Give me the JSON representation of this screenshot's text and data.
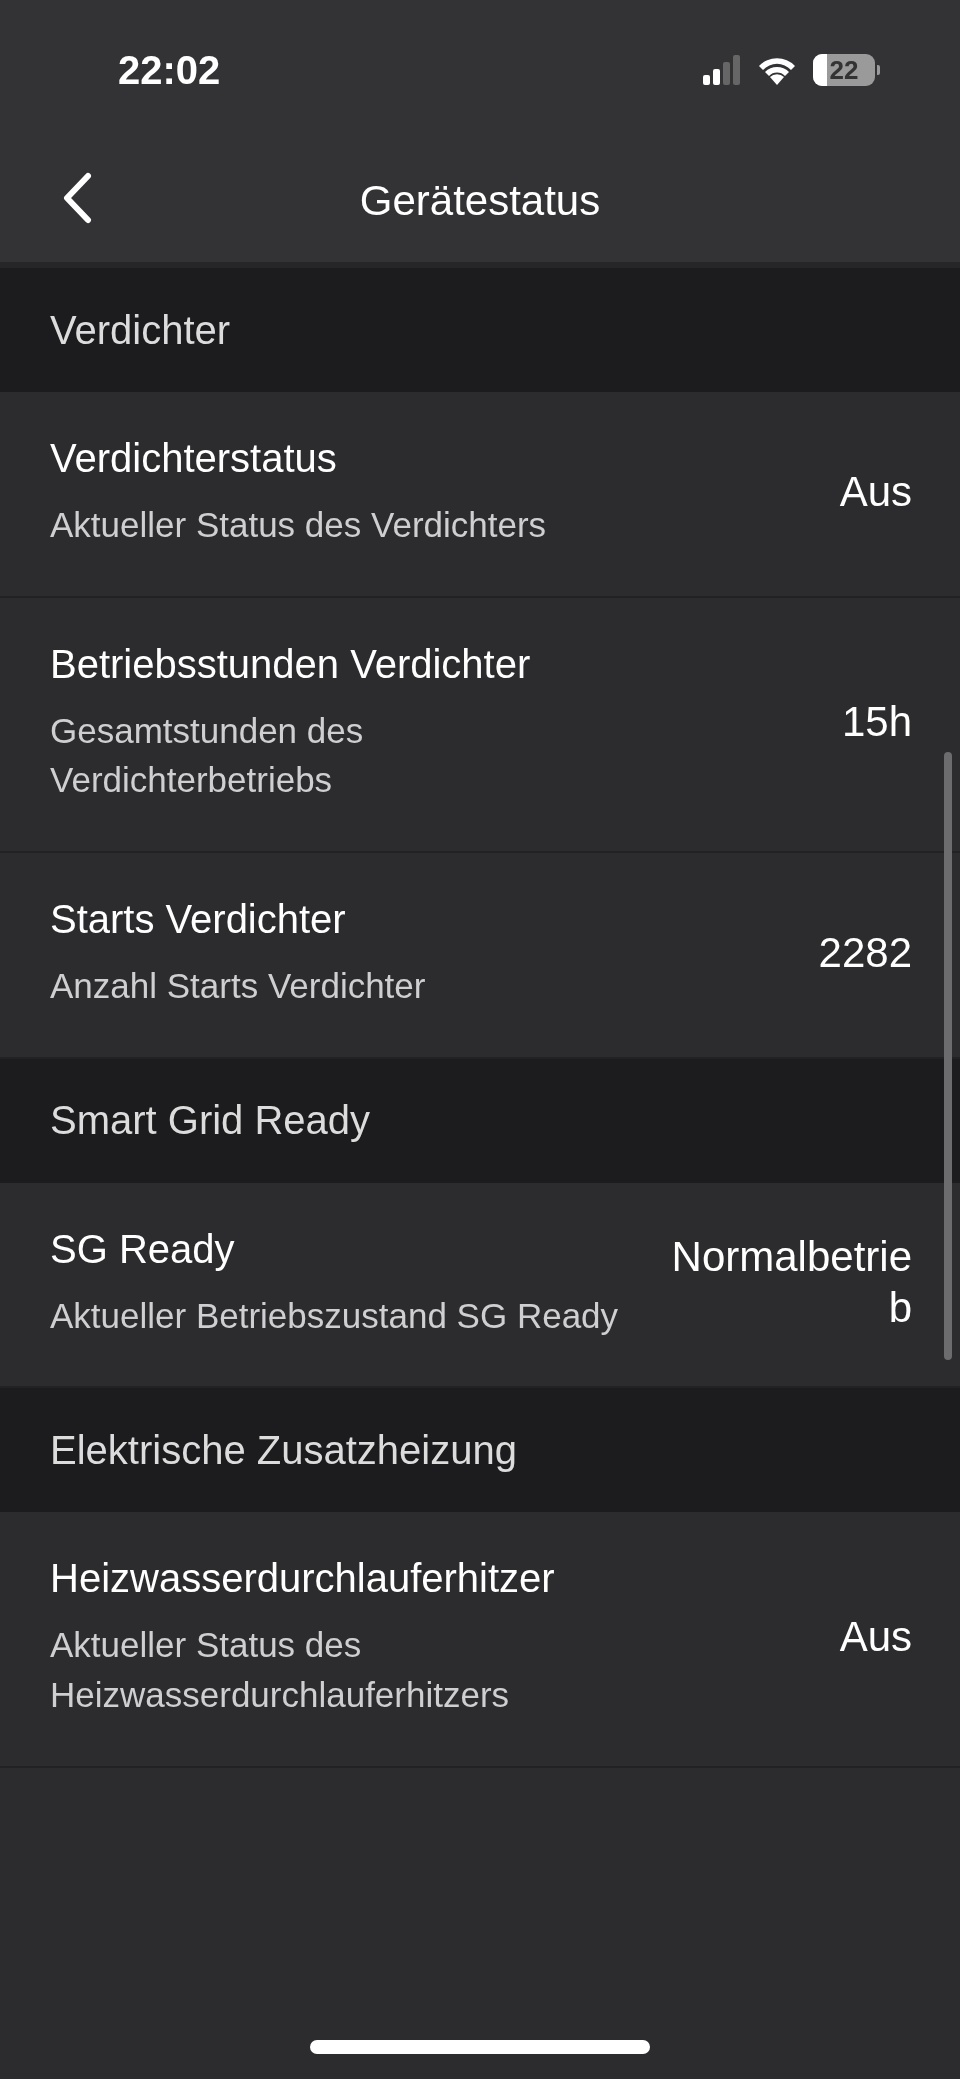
{
  "status_bar": {
    "time": "22:02",
    "battery": "22"
  },
  "nav_bar": {
    "title": "Gerätestatus"
  },
  "sections": [
    {
      "title": "Verdichter",
      "rows": [
        {
          "title": "Verdichterstatus",
          "subtitle": "Aktueller Status des Verdichters",
          "value": "Aus"
        },
        {
          "title": "Betriebsstunden Verdichter",
          "subtitle": "Gesamtstunden des Verdichterbetriebs",
          "value": "15h"
        },
        {
          "title": "Starts Verdichter",
          "subtitle": "Anzahl Starts Verdichter",
          "value": "2282"
        }
      ]
    },
    {
      "title": "Smart Grid Ready",
      "rows": [
        {
          "title": "SG Ready",
          "subtitle": "Aktueller Betriebszustand SG Ready",
          "value": "Normalbetrieb"
        }
      ]
    },
    {
      "title": "Elektrische Zusatzheizung",
      "rows": [
        {
          "title": "Heizwasserdurchlauferhitzer",
          "subtitle": "Aktueller Status des Heizwasserdurchlauferhitzers",
          "value": "Aus"
        }
      ]
    }
  ]
}
